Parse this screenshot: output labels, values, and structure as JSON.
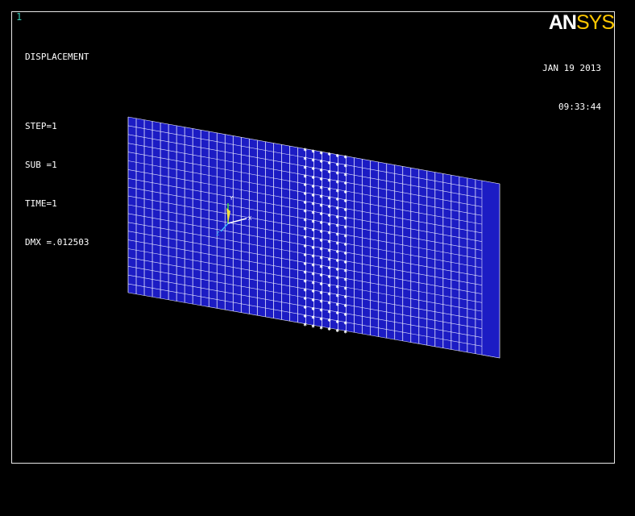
{
  "window": {
    "number": "1"
  },
  "result_info": {
    "title": "DISPLACEMENT",
    "step": "STEP=1",
    "sub": "SUB =1",
    "time": "TIME=1",
    "dmx": "DMX =.012503"
  },
  "logo": {
    "part1": "AN",
    "part2": "SYS"
  },
  "timestamp": {
    "date": "JAN 19 2013",
    "time": "09:33:44"
  },
  "triad": {
    "x_label": "X",
    "y_label": "Y",
    "z_label": "Z"
  },
  "colors": {
    "mesh_fill": "#1c1cc4",
    "mesh_lines": "#e8e8ff",
    "constraint_marks": "#ffffff",
    "logo_accent": "#ffc800",
    "window_number": "#38c8b4",
    "background": "#000000",
    "border": "#e8e8e8"
  },
  "mesh": {
    "columns": 46,
    "rows": 20,
    "constrained_columns_from": 22,
    "constrained_columns_to": 27,
    "constraint_symbol": "✱"
  }
}
